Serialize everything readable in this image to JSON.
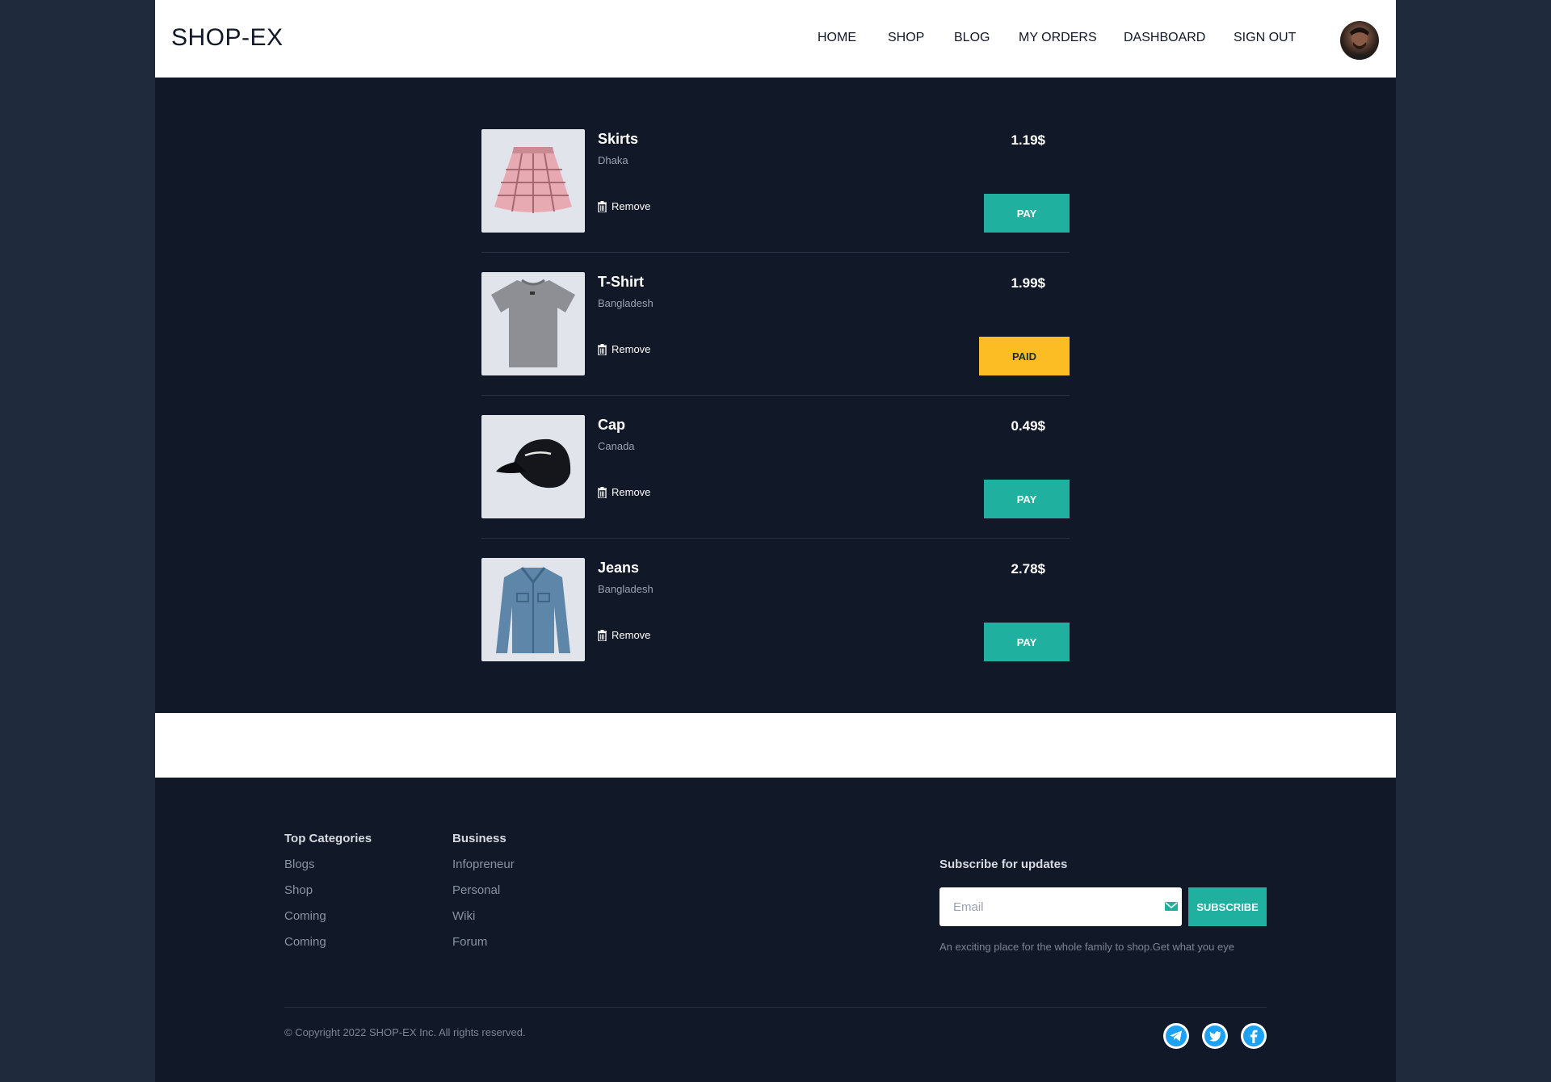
{
  "header": {
    "logo": "SHOP-EX",
    "nav": [
      "HOME",
      "SHOP",
      "BLOG",
      "MY ORDERS",
      "DASHBOARD",
      "SIGN OUT"
    ]
  },
  "orders": [
    {
      "name": "Skirts",
      "location": "Dhaka",
      "remove_label": "Remove",
      "price": "1.19$",
      "button": "PAY",
      "status": "pay",
      "image": "skirt-image"
    },
    {
      "name": "T-Shirt",
      "location": "Bangladesh",
      "remove_label": "Remove",
      "price": "1.99$",
      "button": "PAID",
      "status": "paid",
      "image": "tshirt-image"
    },
    {
      "name": "Cap",
      "location": "Canada",
      "remove_label": "Remove",
      "price": "0.49$",
      "button": "PAY",
      "status": "pay",
      "image": "cap-image"
    },
    {
      "name": "Jeans",
      "location": "Bangladesh",
      "remove_label": "Remove",
      "price": "2.78$",
      "button": "PAY",
      "status": "pay",
      "image": "jeans-jacket-image"
    }
  ],
  "footer": {
    "top_categories": {
      "title": "Top Categories",
      "links": [
        "Blogs",
        "Shop",
        "Coming",
        "Coming"
      ]
    },
    "business": {
      "title": "Business",
      "links": [
        "Infopreneur",
        "Personal",
        "Wiki",
        "Forum"
      ]
    },
    "subscribe": {
      "title": "Subscribe for updates",
      "placeholder": "Email",
      "button": "SUBSCRIBE",
      "description": "An exciting place for the whole family to shop.Get what you eye"
    },
    "copyright": "© Copyright 2022 SHOP-EX Inc. All rights reserved.",
    "social": [
      "telegram-icon",
      "twitter-icon",
      "facebook-icon"
    ]
  },
  "colors": {
    "accent": "#1fb0a0",
    "paid": "#fbbd23",
    "background": "#111827",
    "social": "#1da1f2"
  }
}
